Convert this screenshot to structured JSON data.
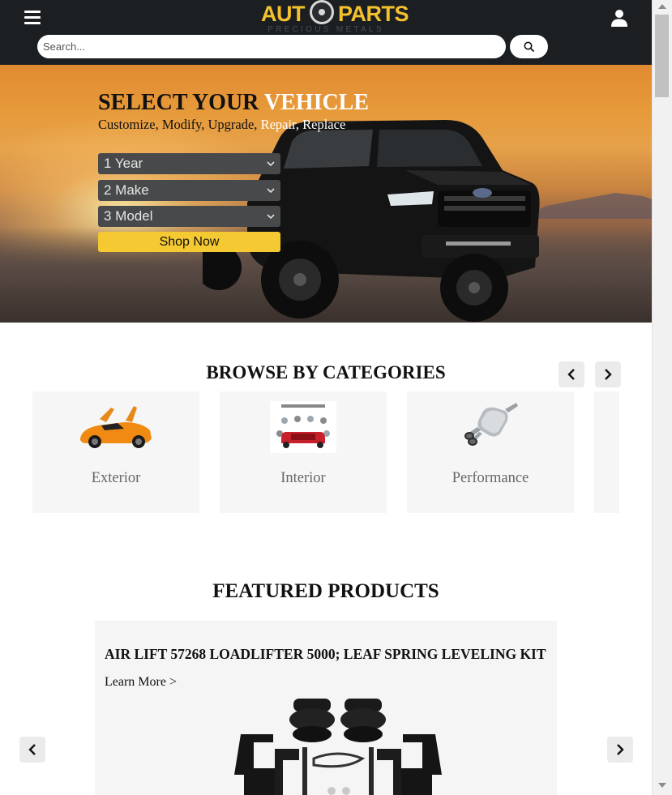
{
  "header": {
    "logo_main": "AUT",
    "logo_parts": "PARTS",
    "logo_sub": "PRECIOUS METALS",
    "search_placeholder": "Search..."
  },
  "hero": {
    "title_part1": "SELECT YOUR ",
    "title_part2": "VEHICLE",
    "subtitle_part1": "Customize, Modify, Upgrade, ",
    "subtitle_part2": "Repair, Replace",
    "selects": [
      {
        "value": "1 Year"
      },
      {
        "value": "2 Make"
      },
      {
        "value": "3 Model"
      }
    ],
    "shop_label": "Shop Now"
  },
  "categories": {
    "title": "BROWSE BY CATEGORIES",
    "items": [
      {
        "label": "Exterior",
        "icon": "sports-car-icon"
      },
      {
        "label": "Interior",
        "icon": "interior-details-icon"
      },
      {
        "label": "Performance",
        "icon": "muffler-icon"
      }
    ]
  },
  "featured": {
    "title": "FEATURED PRODUCTS",
    "product_name": "AIR LIFT 57268 LOADLIFTER 5000; LEAF SPRING LEVELING KIT",
    "learn_more": "Learn More >"
  },
  "colors": {
    "header_bg": "#1c1f22",
    "accent_yellow": "#f5c931",
    "select_bg": "#47494a",
    "card_bg": "#f6f6f6"
  }
}
